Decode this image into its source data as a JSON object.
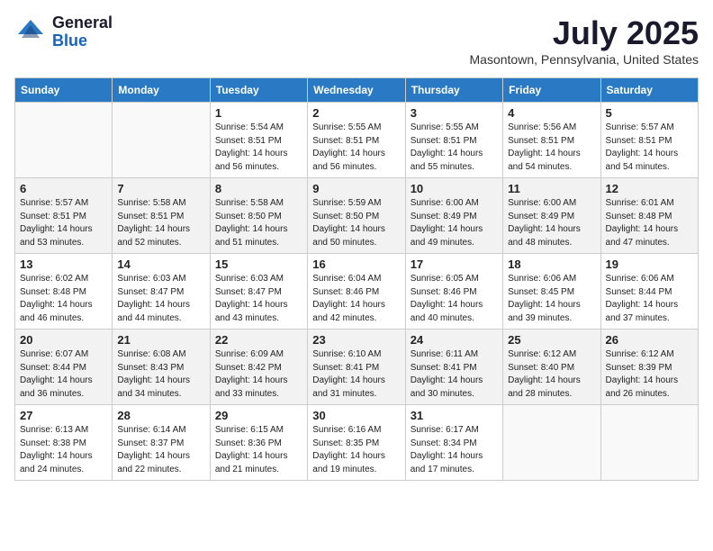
{
  "header": {
    "logo_general": "General",
    "logo_blue": "Blue",
    "month_title": "July 2025",
    "location": "Masontown, Pennsylvania, United States"
  },
  "weekdays": [
    "Sunday",
    "Monday",
    "Tuesday",
    "Wednesday",
    "Thursday",
    "Friday",
    "Saturday"
  ],
  "weeks": [
    [
      {
        "day": "",
        "sunrise": "",
        "sunset": "",
        "daylight": ""
      },
      {
        "day": "",
        "sunrise": "",
        "sunset": "",
        "daylight": ""
      },
      {
        "day": "1",
        "sunrise": "Sunrise: 5:54 AM",
        "sunset": "Sunset: 8:51 PM",
        "daylight": "Daylight: 14 hours and 56 minutes."
      },
      {
        "day": "2",
        "sunrise": "Sunrise: 5:55 AM",
        "sunset": "Sunset: 8:51 PM",
        "daylight": "Daylight: 14 hours and 56 minutes."
      },
      {
        "day": "3",
        "sunrise": "Sunrise: 5:55 AM",
        "sunset": "Sunset: 8:51 PM",
        "daylight": "Daylight: 14 hours and 55 minutes."
      },
      {
        "day": "4",
        "sunrise": "Sunrise: 5:56 AM",
        "sunset": "Sunset: 8:51 PM",
        "daylight": "Daylight: 14 hours and 54 minutes."
      },
      {
        "day": "5",
        "sunrise": "Sunrise: 5:57 AM",
        "sunset": "Sunset: 8:51 PM",
        "daylight": "Daylight: 14 hours and 54 minutes."
      }
    ],
    [
      {
        "day": "6",
        "sunrise": "Sunrise: 5:57 AM",
        "sunset": "Sunset: 8:51 PM",
        "daylight": "Daylight: 14 hours and 53 minutes."
      },
      {
        "day": "7",
        "sunrise": "Sunrise: 5:58 AM",
        "sunset": "Sunset: 8:51 PM",
        "daylight": "Daylight: 14 hours and 52 minutes."
      },
      {
        "day": "8",
        "sunrise": "Sunrise: 5:58 AM",
        "sunset": "Sunset: 8:50 PM",
        "daylight": "Daylight: 14 hours and 51 minutes."
      },
      {
        "day": "9",
        "sunrise": "Sunrise: 5:59 AM",
        "sunset": "Sunset: 8:50 PM",
        "daylight": "Daylight: 14 hours and 50 minutes."
      },
      {
        "day": "10",
        "sunrise": "Sunrise: 6:00 AM",
        "sunset": "Sunset: 8:49 PM",
        "daylight": "Daylight: 14 hours and 49 minutes."
      },
      {
        "day": "11",
        "sunrise": "Sunrise: 6:00 AM",
        "sunset": "Sunset: 8:49 PM",
        "daylight": "Daylight: 14 hours and 48 minutes."
      },
      {
        "day": "12",
        "sunrise": "Sunrise: 6:01 AM",
        "sunset": "Sunset: 8:48 PM",
        "daylight": "Daylight: 14 hours and 47 minutes."
      }
    ],
    [
      {
        "day": "13",
        "sunrise": "Sunrise: 6:02 AM",
        "sunset": "Sunset: 8:48 PM",
        "daylight": "Daylight: 14 hours and 46 minutes."
      },
      {
        "day": "14",
        "sunrise": "Sunrise: 6:03 AM",
        "sunset": "Sunset: 8:47 PM",
        "daylight": "Daylight: 14 hours and 44 minutes."
      },
      {
        "day": "15",
        "sunrise": "Sunrise: 6:03 AM",
        "sunset": "Sunset: 8:47 PM",
        "daylight": "Daylight: 14 hours and 43 minutes."
      },
      {
        "day": "16",
        "sunrise": "Sunrise: 6:04 AM",
        "sunset": "Sunset: 8:46 PM",
        "daylight": "Daylight: 14 hours and 42 minutes."
      },
      {
        "day": "17",
        "sunrise": "Sunrise: 6:05 AM",
        "sunset": "Sunset: 8:46 PM",
        "daylight": "Daylight: 14 hours and 40 minutes."
      },
      {
        "day": "18",
        "sunrise": "Sunrise: 6:06 AM",
        "sunset": "Sunset: 8:45 PM",
        "daylight": "Daylight: 14 hours and 39 minutes."
      },
      {
        "day": "19",
        "sunrise": "Sunrise: 6:06 AM",
        "sunset": "Sunset: 8:44 PM",
        "daylight": "Daylight: 14 hours and 37 minutes."
      }
    ],
    [
      {
        "day": "20",
        "sunrise": "Sunrise: 6:07 AM",
        "sunset": "Sunset: 8:44 PM",
        "daylight": "Daylight: 14 hours and 36 minutes."
      },
      {
        "day": "21",
        "sunrise": "Sunrise: 6:08 AM",
        "sunset": "Sunset: 8:43 PM",
        "daylight": "Daylight: 14 hours and 34 minutes."
      },
      {
        "day": "22",
        "sunrise": "Sunrise: 6:09 AM",
        "sunset": "Sunset: 8:42 PM",
        "daylight": "Daylight: 14 hours and 33 minutes."
      },
      {
        "day": "23",
        "sunrise": "Sunrise: 6:10 AM",
        "sunset": "Sunset: 8:41 PM",
        "daylight": "Daylight: 14 hours and 31 minutes."
      },
      {
        "day": "24",
        "sunrise": "Sunrise: 6:11 AM",
        "sunset": "Sunset: 8:41 PM",
        "daylight": "Daylight: 14 hours and 30 minutes."
      },
      {
        "day": "25",
        "sunrise": "Sunrise: 6:12 AM",
        "sunset": "Sunset: 8:40 PM",
        "daylight": "Daylight: 14 hours and 28 minutes."
      },
      {
        "day": "26",
        "sunrise": "Sunrise: 6:12 AM",
        "sunset": "Sunset: 8:39 PM",
        "daylight": "Daylight: 14 hours and 26 minutes."
      }
    ],
    [
      {
        "day": "27",
        "sunrise": "Sunrise: 6:13 AM",
        "sunset": "Sunset: 8:38 PM",
        "daylight": "Daylight: 14 hours and 24 minutes."
      },
      {
        "day": "28",
        "sunrise": "Sunrise: 6:14 AM",
        "sunset": "Sunset: 8:37 PM",
        "daylight": "Daylight: 14 hours and 22 minutes."
      },
      {
        "day": "29",
        "sunrise": "Sunrise: 6:15 AM",
        "sunset": "Sunset: 8:36 PM",
        "daylight": "Daylight: 14 hours and 21 minutes."
      },
      {
        "day": "30",
        "sunrise": "Sunrise: 6:16 AM",
        "sunset": "Sunset: 8:35 PM",
        "daylight": "Daylight: 14 hours and 19 minutes."
      },
      {
        "day": "31",
        "sunrise": "Sunrise: 6:17 AM",
        "sunset": "Sunset: 8:34 PM",
        "daylight": "Daylight: 14 hours and 17 minutes."
      },
      {
        "day": "",
        "sunrise": "",
        "sunset": "",
        "daylight": ""
      },
      {
        "day": "",
        "sunrise": "",
        "sunset": "",
        "daylight": ""
      }
    ]
  ]
}
